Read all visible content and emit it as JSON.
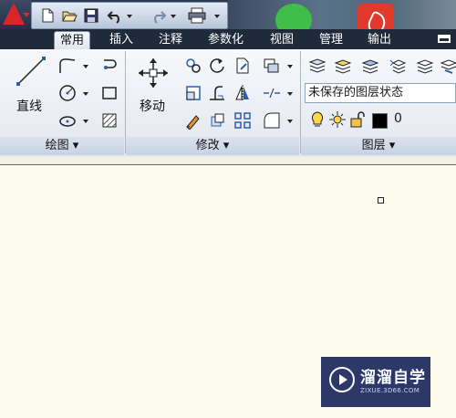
{
  "app": {
    "logo_letter": "A"
  },
  "tabs": [
    {
      "label": "常用",
      "active": true
    },
    {
      "label": "插入"
    },
    {
      "label": "注释"
    },
    {
      "label": "参数化"
    },
    {
      "label": "视图"
    },
    {
      "label": "管理"
    },
    {
      "label": "输出"
    }
  ],
  "ribbon": {
    "draw": {
      "title": "绘图",
      "line_label": "直线"
    },
    "modify": {
      "title": "修改",
      "move_label": "移动"
    },
    "layers": {
      "title": "图层",
      "layer_state": "未保存的图层状态",
      "current_layer": "0",
      "layer_color": "#000000"
    }
  },
  "watermark": {
    "title": "溜溜自学",
    "url": "ZIXUE.3D66.COM"
  },
  "colors": {
    "ribbon_bg": "#e9edf3",
    "tab_bar": "#1f2a3b",
    "canvas_bg": "#fdfaee",
    "autocad_red": "#d8262a",
    "watermark_bg": "#2b3868"
  }
}
